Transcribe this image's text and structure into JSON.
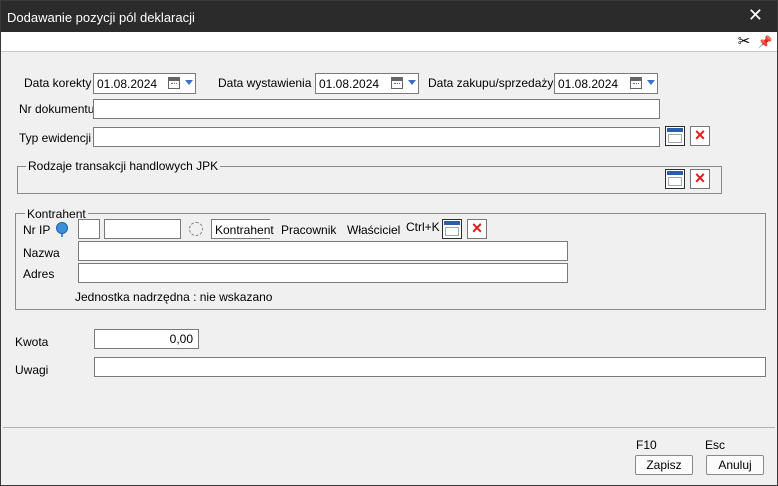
{
  "window": {
    "title": "Dodawanie pozycji pól deklaracji",
    "close_glyph": "✕"
  },
  "toolbar": {
    "cut_icon": "scissors-icon",
    "pin_icon": "pin-icon",
    "cut_glyph": "✂",
    "pin_glyph": "📌"
  },
  "form": {
    "data_korekty": {
      "label": "Data korekty",
      "value": "01.08.2024"
    },
    "data_wystawienia": {
      "label": "Data wystawienia",
      "value": "01.08.2024"
    },
    "data_zakupu": {
      "label": "Data zakupu/sprzedaży",
      "value": "01.08.2024"
    },
    "nr_dokumentu": {
      "label": "Nr dokumentu",
      "value": ""
    },
    "typ_ewidencji": {
      "label": "Typ ewidencji",
      "value": ""
    },
    "rodzaje_group": {
      "label": "Rodzaje transakcji handlowych JPK"
    },
    "kontrahent": {
      "legend": "Kontrahent",
      "nr_ip_label": "Nr IP",
      "nr_ip_prefix": "",
      "nr_ip_value": "",
      "type_kontrahent": "Kontrahent",
      "type_pracownik": "Pracownik",
      "type_wlasciciel": "Właściciel",
      "shortcut": "Ctrl+K",
      "nazwa_label": "Nazwa",
      "nazwa_value": "",
      "adres_label": "Adres",
      "adres_value": "",
      "jednostka_text": "Jednostka nadrzędna : nie wskazano"
    },
    "kwota": {
      "label": "Kwota",
      "value": "0,00"
    },
    "uwagi": {
      "label": "Uwagi",
      "value": ""
    }
  },
  "footer": {
    "save_shortcut": "F10",
    "save_label": "Zapisz",
    "cancel_shortcut": "Esc",
    "cancel_label": "Anuluj"
  },
  "colors": {
    "titlebar": "#2b2b2b",
    "body": "#f0f0f0",
    "delete_red": "#e02020",
    "accent_blue": "#2a5db0"
  }
}
